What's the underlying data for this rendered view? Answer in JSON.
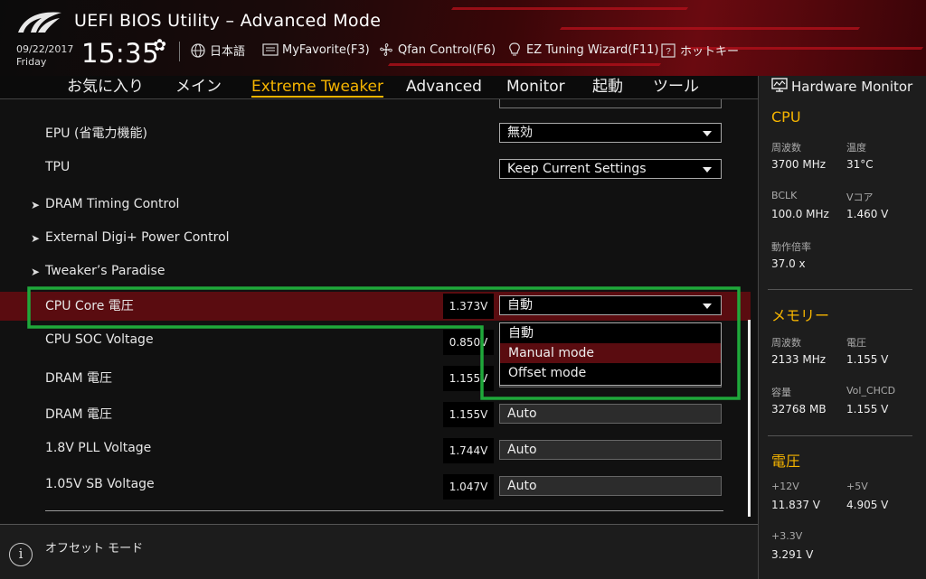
{
  "header": {
    "title": "UEFI BIOS Utility – Advanced Mode",
    "date": "09/22/2017",
    "day": "Friday",
    "time": "15:35",
    "items": [
      {
        "label": "日本語",
        "icon": "globe-icon"
      },
      {
        "label": "MyFavorite(F3)",
        "icon": "favorite-icon"
      },
      {
        "label": "Qfan Control(F6)",
        "icon": "fan-icon"
      },
      {
        "label": "EZ Tuning Wizard(F11)",
        "icon": "lightbulb-icon"
      },
      {
        "label": "ホットキー",
        "icon": "help-icon"
      }
    ]
  },
  "nav": {
    "tabs": [
      "お気に入り",
      "メイン",
      "Extreme Tweaker",
      "Advanced",
      "Monitor",
      "起動",
      "ツール"
    ],
    "active": "Extreme Tweaker"
  },
  "main": {
    "epu": {
      "label": "EPU (省電力機能)",
      "value": "無効"
    },
    "tpu": {
      "label": "TPU",
      "value": "Keep Current Settings"
    },
    "submenus": [
      "DRAM Timing Control",
      "External Digi+ Power Control",
      "Tweaker’s Paradise"
    ],
    "cpu_core": {
      "label": "CPU Core 電圧",
      "voltage": "1.373V",
      "value": "自動"
    },
    "rows": [
      {
        "label": "CPU SOC Voltage",
        "voltage": "0.850V",
        "value": ""
      },
      {
        "label": "DRAM 電圧",
        "voltage": "1.155V",
        "value": ""
      },
      {
        "label": "DRAM 電圧",
        "voltage": "1.155V",
        "value": "Auto"
      },
      {
        "label": "1.8V PLL Voltage",
        "voltage": "1.744V",
        "value": "Auto"
      },
      {
        "label": "1.05V SB Voltage",
        "voltage": "1.047V",
        "value": "Auto"
      }
    ],
    "popup_options": [
      "自動",
      "Manual mode",
      "Offset mode"
    ],
    "popup_highlighted": "Manual mode"
  },
  "info": {
    "text": "オフセット モード"
  },
  "monitor": {
    "title": "Hardware Monitor",
    "cpu": {
      "heading": "CPU",
      "freq_label": "周波数",
      "freq": "3700 MHz",
      "temp_label": "温度",
      "temp": "31°C",
      "bclk_label": "BCLK",
      "bclk": "100.0 MHz",
      "vcore_label": "Vコア",
      "vcore": "1.460 V",
      "ratio_label": "動作倍率",
      "ratio": "37.0 x"
    },
    "memory": {
      "heading": "メモリー",
      "freq_label": "周波数",
      "freq": "2133 MHz",
      "volt_label": "電圧",
      "volt": "1.155 V",
      "cap_label": "容量",
      "cap": "32768 MB",
      "chcd_label": "Vol_CHCD",
      "chcd": "1.155 V"
    },
    "voltage": {
      "heading": "電圧",
      "v12_label": "+12V",
      "v12": "11.837 V",
      "v5_label": "+5V",
      "v5": "4.905 V",
      "v33_label": "+3.3V",
      "v33": "3.291 V"
    }
  },
  "colors": {
    "accent": "#f5b400",
    "selection": "#5a0c10",
    "highlight_box": "#1fa83a"
  }
}
